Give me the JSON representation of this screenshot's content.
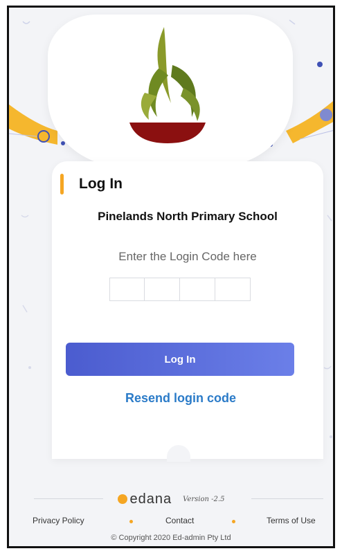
{
  "login": {
    "title": "Log In",
    "school_name": "Pinelands North Primary School",
    "code_prompt": "Enter the Login Code here",
    "code_digits": [
      "",
      "",
      "",
      ""
    ],
    "button_label": "Log In",
    "resend_label": "Resend login code"
  },
  "brand": {
    "name": "edana",
    "version": "Version -2.5"
  },
  "footer": {
    "privacy": "Privacy Policy",
    "contact": "Contact",
    "terms": "Terms of Use",
    "copyright": "© Copyright 2020 Ed-admin Pty Ltd"
  },
  "colors": {
    "accent": "#f5a623",
    "button": "#5568d8",
    "link": "#2b7bc8",
    "logo_green": "#8a9a2a",
    "logo_red": "#8b1010"
  },
  "icons": {
    "school_logo": "school-crest-icon",
    "brand_logo": "edana-logo-icon"
  }
}
